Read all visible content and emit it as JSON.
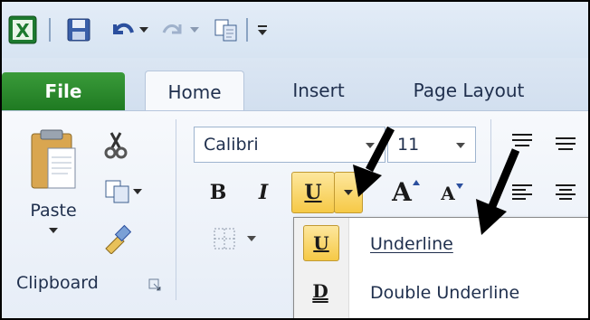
{
  "quick_access": {
    "icons": [
      "excel-icon",
      "save-icon",
      "undo-icon",
      "undo-dropdown-icon",
      "redo-icon",
      "redo-dropdown-icon",
      "copy-icon",
      "customize-qat-icon"
    ]
  },
  "tabs": [
    {
      "label": "File"
    },
    {
      "label": "Home"
    },
    {
      "label": "Insert"
    },
    {
      "label": "Page Layout"
    }
  ],
  "clipboard": {
    "paste_label": "Paste",
    "group_label": "Clipboard"
  },
  "font": {
    "name_value": "Calibri",
    "size_value": "11",
    "bold_label": "B",
    "italic_label": "I",
    "underline_label": "U",
    "grow_label": "A",
    "shrink_label": "A"
  },
  "underline_menu": {
    "items": [
      {
        "label": "Underline",
        "icon_glyph": "U"
      },
      {
        "label": "Double Underline",
        "icon_glyph": "D"
      }
    ]
  },
  "colors": {
    "file_tab": "#2a8a2e",
    "highlight": "#fbd46a",
    "arrow": "#000000"
  }
}
